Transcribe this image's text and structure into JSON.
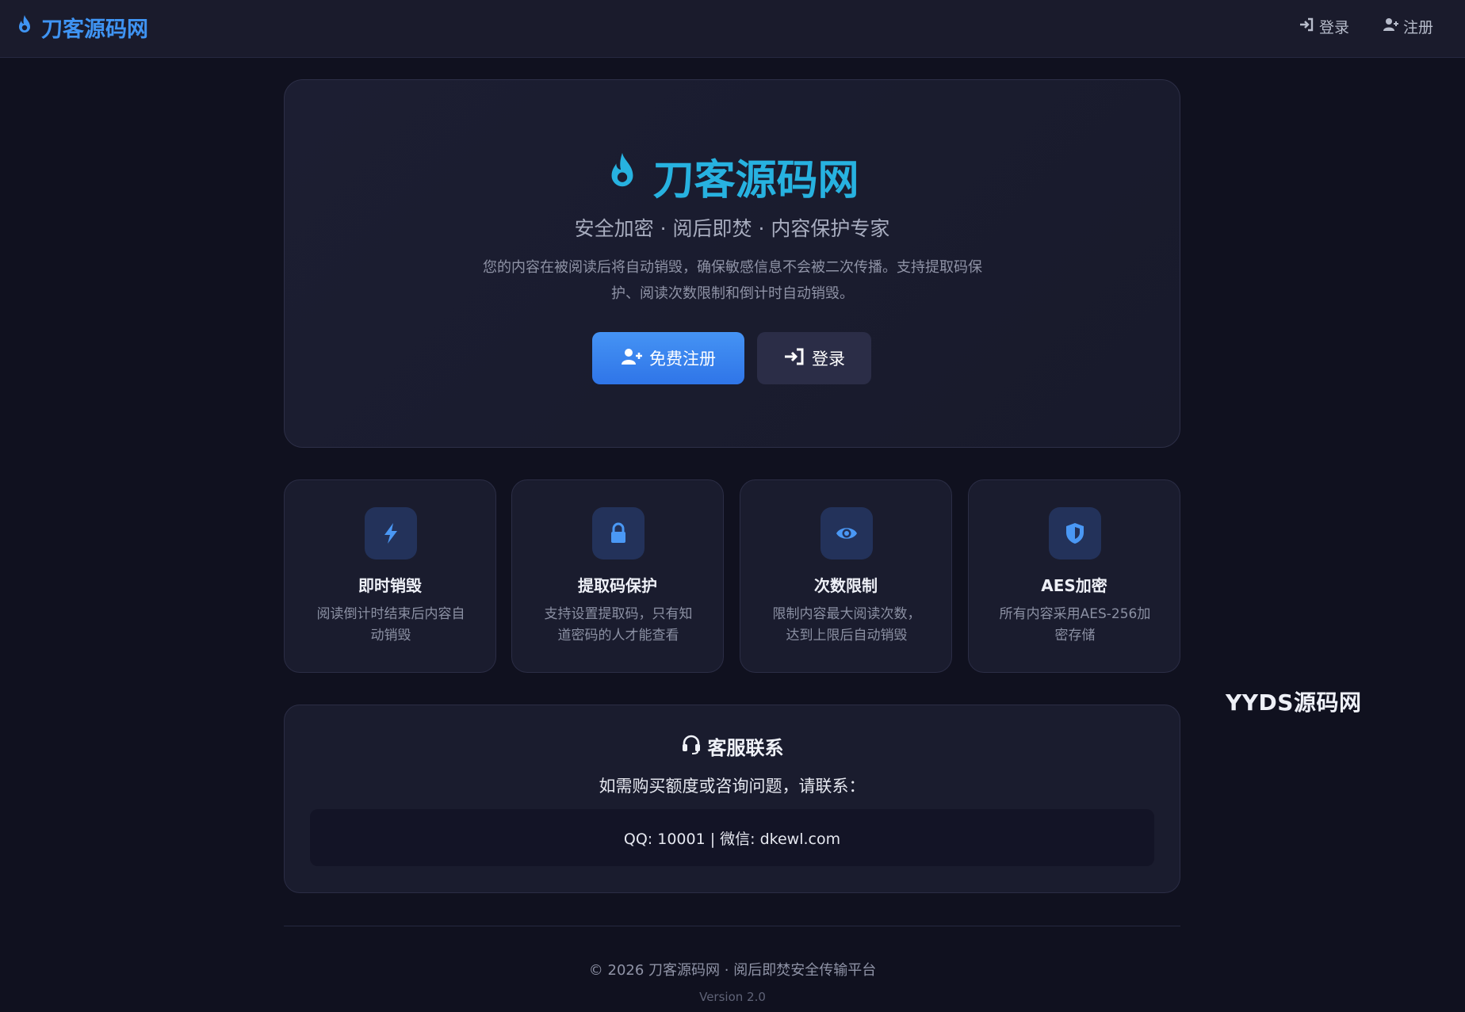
{
  "header": {
    "brand": "刀客源码网",
    "nav": [
      {
        "label": "登录",
        "icon": "login-icon"
      },
      {
        "label": "注册",
        "icon": "user-plus-icon"
      }
    ]
  },
  "hero": {
    "title": "刀客源码网",
    "subtitle": "安全加密 · 阅后即焚 · 内容保护专家",
    "description": "您的内容在被阅读后将自动销毁，确保敏感信息不会被二次传播。支持提取码保护、阅读次数限制和倒计时自动销毁。",
    "primary_button": "免费注册",
    "secondary_button": "登录"
  },
  "features": [
    {
      "icon": "bolt-icon",
      "title": "即时销毁",
      "desc": "阅读倒计时结束后内容自动销毁"
    },
    {
      "icon": "lock-icon",
      "title": "提取码保护",
      "desc": "支持设置提取码，只有知道密码的人才能查看"
    },
    {
      "icon": "eye-icon",
      "title": "次数限制",
      "desc": "限制内容最大阅读次数，达到上限后自动销毁"
    },
    {
      "icon": "shield-icon",
      "title": "AES加密",
      "desc": "所有内容采用AES-256加密存储"
    }
  ],
  "contact": {
    "title": "客服联系",
    "text": "如需购买额度或咨询问题，请联系：",
    "info": "QQ: 10001 | 微信: dkewl.com"
  },
  "footer": {
    "copyright": "© 2026 刀客源码网 · 阅后即焚安全传输平台",
    "version": "Version 2.0"
  },
  "watermark": "YYDS源码网",
  "colors": {
    "accent": "#3f94f3",
    "hero_title": "#27b2e0",
    "background": "#10111f"
  }
}
